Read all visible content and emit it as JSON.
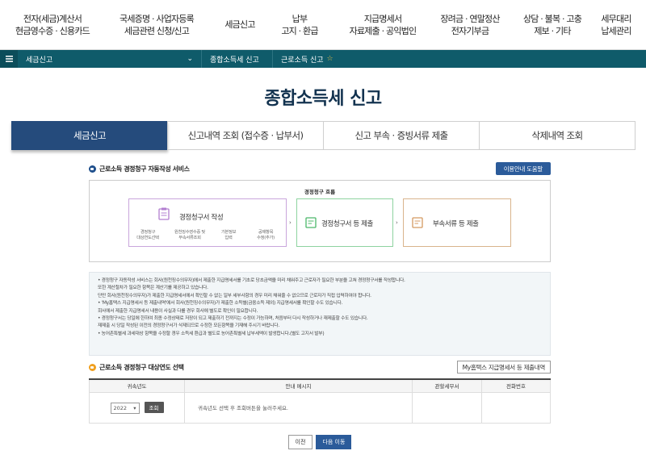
{
  "topnav": [
    {
      "line1": "전자(세금)계산서",
      "line2": "현금영수증 · 신용카드"
    },
    {
      "line1": "국세증명 · 사업자등록",
      "line2": "세금관련 신청/신고"
    },
    {
      "line1": "세금신고",
      "line2": ""
    },
    {
      "line1": "납부",
      "line2": "고지 · 환급"
    },
    {
      "line1": "지급명세서",
      "line2": "자료제출 · 공익법인"
    },
    {
      "line1": "장려금 · 연말정산",
      "line2": "전자기부금"
    },
    {
      "line1": "상담 · 불복 · 고충",
      "line2": "제보 · 기타"
    },
    {
      "line1": "세무대리",
      "line2": "납세관리"
    }
  ],
  "breadcrumb": {
    "level1": "세금신고",
    "level2": "종합소득세 신고",
    "level3": "근로소득 신고",
    "star": "☆"
  },
  "page_title": "종합소득세 신고",
  "tabs": [
    "세금신고",
    "신고내역 조회 (접수증 · 납부서)",
    "신고 부속 · 증빙서류 제출",
    "삭제내역 조회"
  ],
  "service": {
    "heading": "근로소득 경정청구 자동작성 서비스",
    "help_button": "이용안내 도움말",
    "flow_title": "경정청구 흐름",
    "step1": "경정청구서 작성",
    "step1_subs": [
      "경정청구\n대상연도선택",
      "원천징수영수증 및\n부속서류조회",
      "기본정보\n입력",
      "공제항목\n수정(추가)"
    ],
    "step2": "경정청구서 등 제출",
    "step3": "부속서류 등 제출"
  },
  "info_lines": [
    "• 경정청구 자동작성 서비스는 회사(원천징수의무자)에서 제출한 지급명세서를 기초로 당초금액을 미리 채워주고 근로자가 필요한 부분을 고쳐 경정청구서를 작성합니다.",
    "  또한 계산절차가 필요한 항목은 계산기를 제공하고 있습니다.",
    "  단만 회사(원천징수의무자)가 제출한 지급명세서에서 확인할 수 없는 일부 세부사항의 경우 미리 채워줄 수 없으므로 근로자가 직접 입력하여야 합니다.",
    "• 'My홈택스 지급명세서 등 제출내역'에서 회사(원천징수의무자)가 제출한 소득별(금융소득 제외) 지급명세서를 확인할 수도 있습니다.",
    "  회사에서 제출한 지급명세서 내용이 사실과 다를 경우 회사에 별도로 확인이 필요합니다.",
    "• 경정청구서는 당일에 한하여 최종 수정상태로 저장이 되고 제출하기 전까지는 수정이 가능하며, 처음부터 다시 작성하거나 재제출할 수도 있습니다.",
    "  재제출 시 당일 작성된 이전의 경정청구서가 삭제되므로 수정한 모든항목을 기재해 주시기 바랍니다.",
    "• 농어촌특별세 과세대상 항목을 수정할 경우 소득세 환급과 별도로 농어촌특별세 납부세액이 발생합니다.(별도 고지서 발부)"
  ],
  "year_section": {
    "heading": "근로소득 경정청구 대상연도 선택",
    "mybutton": "My홈택스 지급명세서 등 제출내역",
    "columns": [
      "귀속년도",
      "안내 메시지",
      "관할세무서",
      "전화번호"
    ],
    "year": "2022",
    "query_button": "조회",
    "message": "귀속년도 선택 후 조회버튼을 눌러주세요."
  },
  "buttons": {
    "prev": "이전",
    "next": "다음 이동"
  }
}
